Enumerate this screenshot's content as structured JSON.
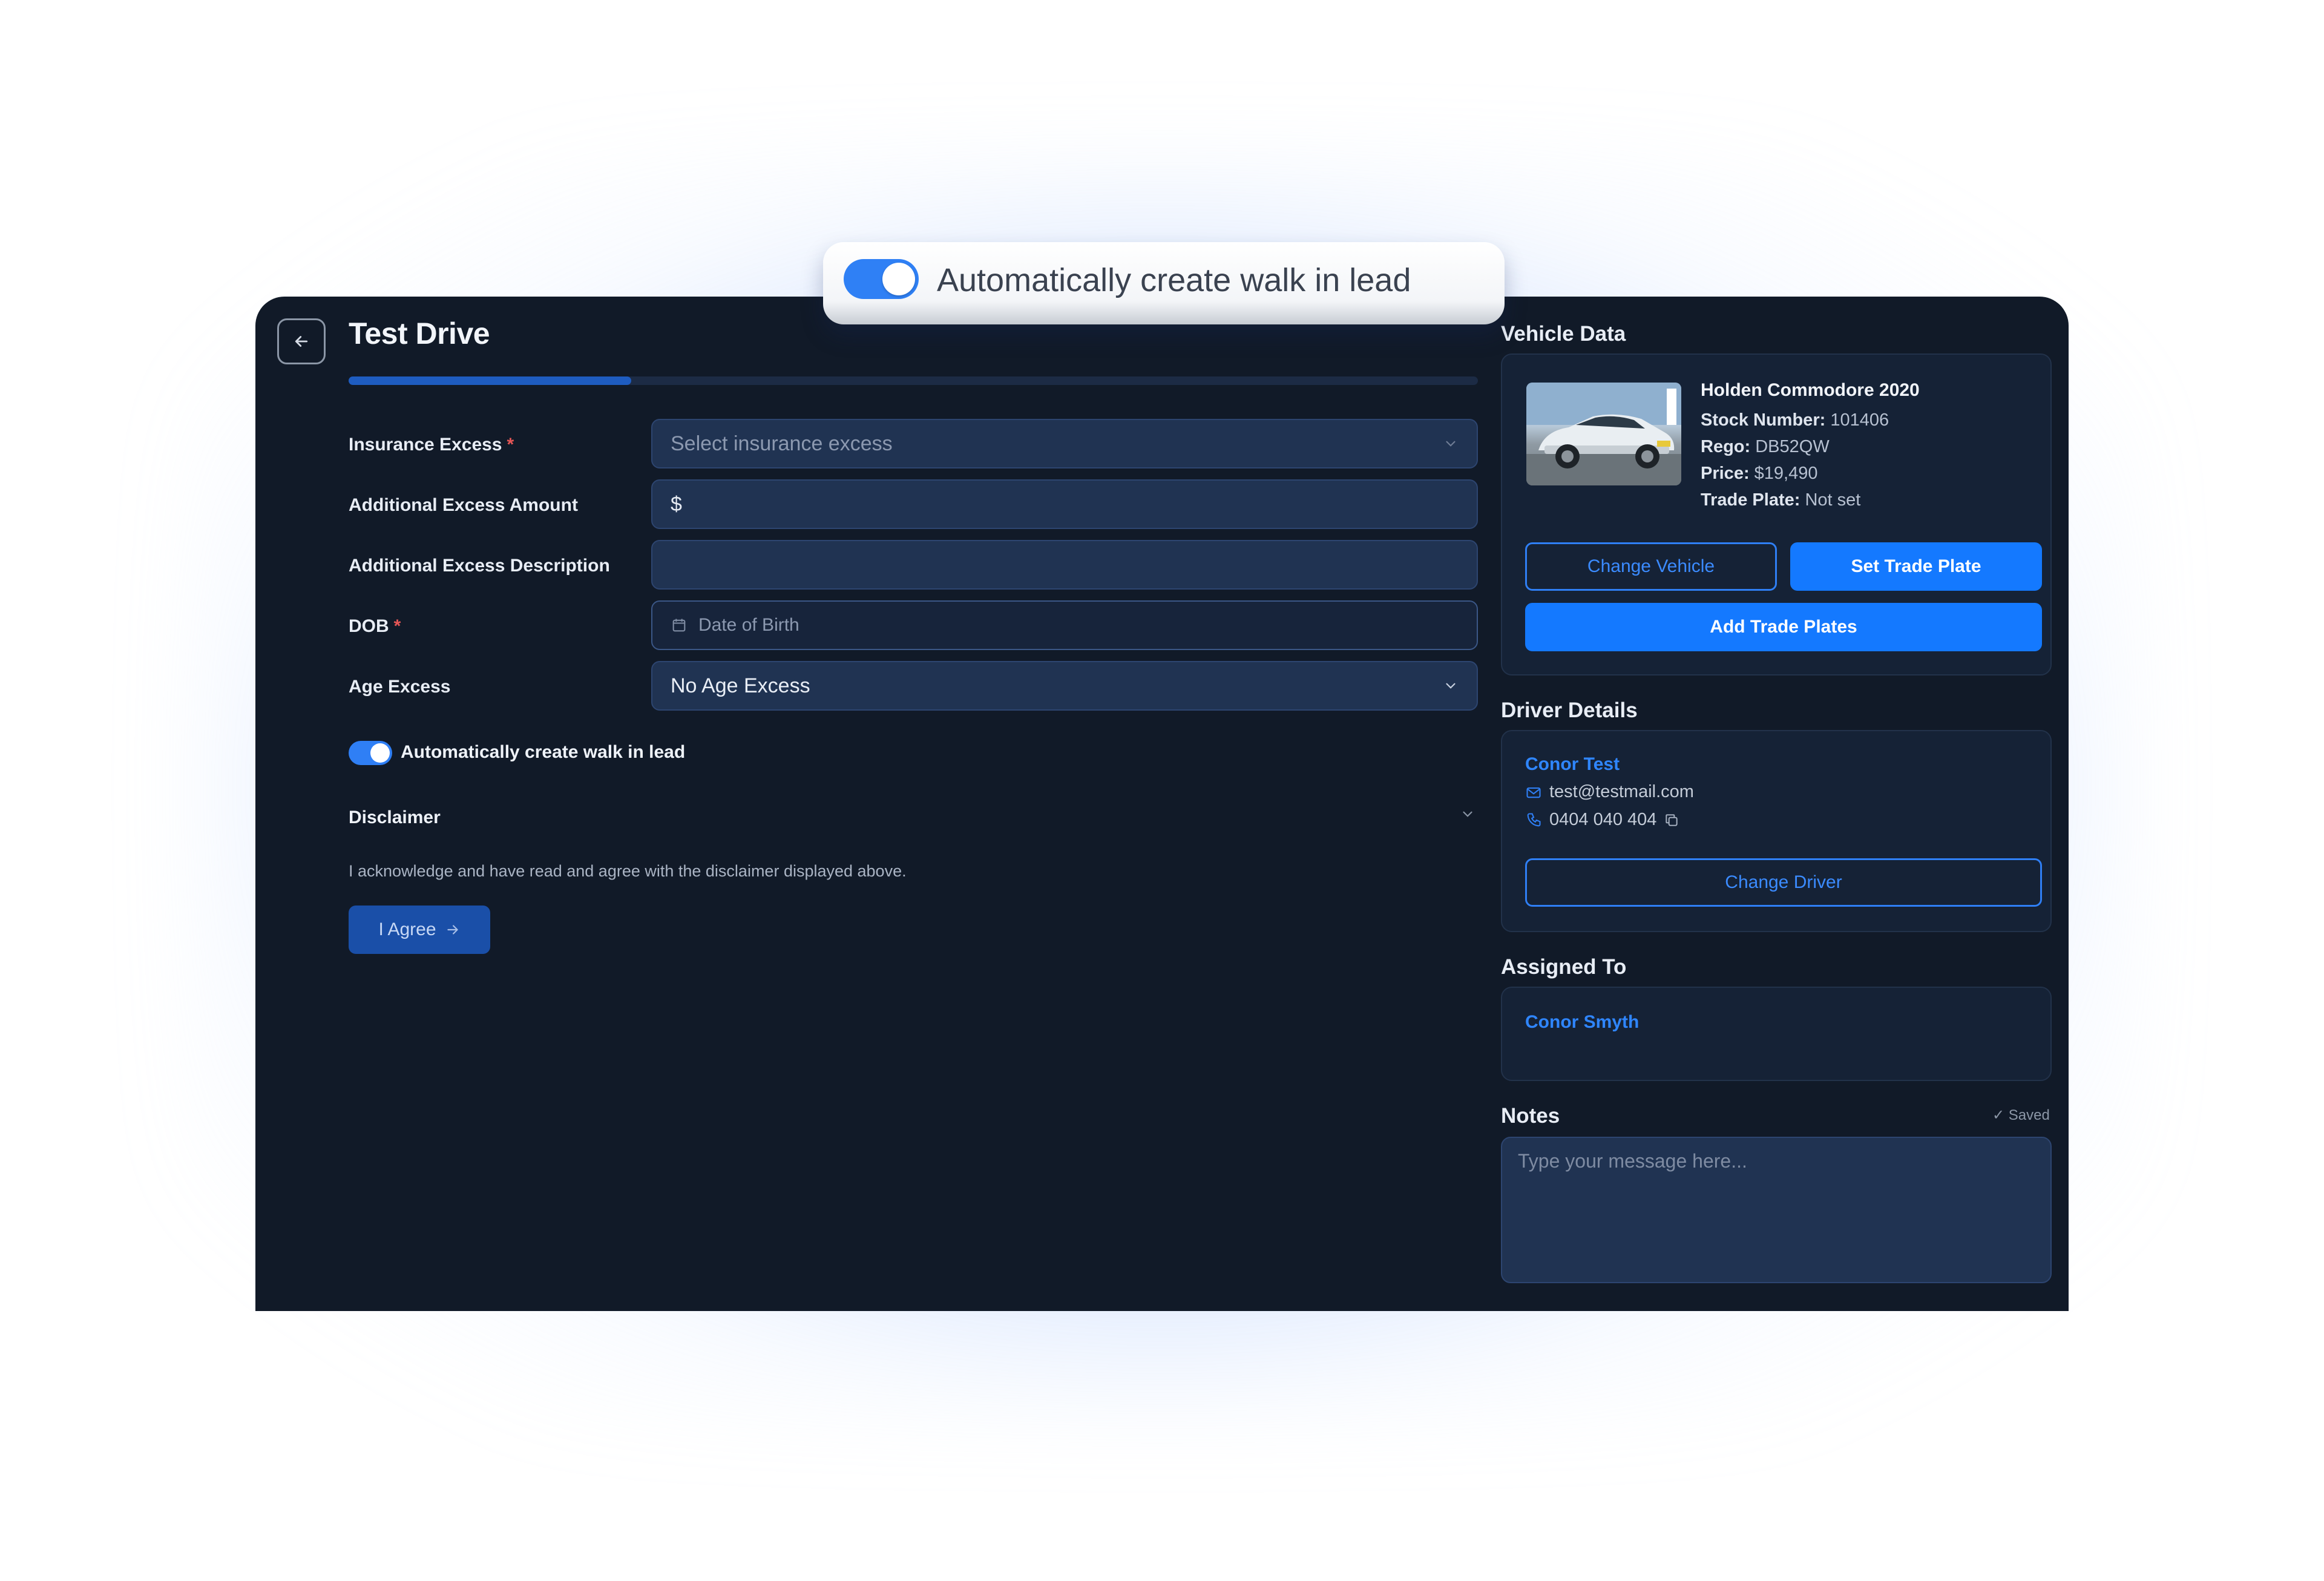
{
  "callout": {
    "toggle_on": true,
    "label": "Automatically create walk in lead"
  },
  "header": {
    "title": "Test Drive",
    "progress": 0.25
  },
  "form": {
    "insurance_excess": {
      "label": "Insurance Excess",
      "required": "*",
      "placeholder": "Select insurance excess"
    },
    "additional_excess_amount": {
      "label": "Additional Excess Amount",
      "prefix": "$"
    },
    "additional_excess_description": {
      "label": "Additional Excess Description",
      "value": ""
    },
    "dob": {
      "label": "DOB",
      "required": "*",
      "placeholder": "Date of Birth"
    },
    "age_excess": {
      "label": "Age Excess",
      "value": "No Age Excess"
    },
    "walk_in_lead": {
      "toggle_on": true,
      "label": "Automatically create walk in lead"
    }
  },
  "disclaimer": {
    "title": "Disclaimer",
    "text": "I acknowledge and have read and agree with the disclaimer displayed above.",
    "agree_label": "I Agree"
  },
  "vehicle": {
    "section_title": "Vehicle Data",
    "name": "Holden Commodore 2020",
    "stock_label": "Stock Number:",
    "stock_value": "101406",
    "rego_label": "Rego:",
    "rego_value": "DB52QW",
    "price_label": "Price:",
    "price_value": "$19,490",
    "trade_plate_label": "Trade Plate:",
    "trade_plate_value": "Not set",
    "change_vehicle_label": "Change Vehicle",
    "set_trade_plate_label": "Set Trade Plate",
    "add_trade_plates_label": "Add Trade Plates"
  },
  "driver": {
    "section_title": "Driver Details",
    "name": "Conor Test",
    "email": "test@testmail.com",
    "phone": "0404 040 404",
    "change_driver_label": "Change Driver"
  },
  "assigned": {
    "section_title": "Assigned To",
    "name": "Conor Smyth"
  },
  "notes": {
    "section_title": "Notes",
    "saved_label": "✓ Saved",
    "placeholder": "Type your message here..."
  },
  "colors": {
    "accent": "#1479ff",
    "panel_bg": "#111a28",
    "card_bg": "#152236",
    "input_bg": "#203352"
  }
}
